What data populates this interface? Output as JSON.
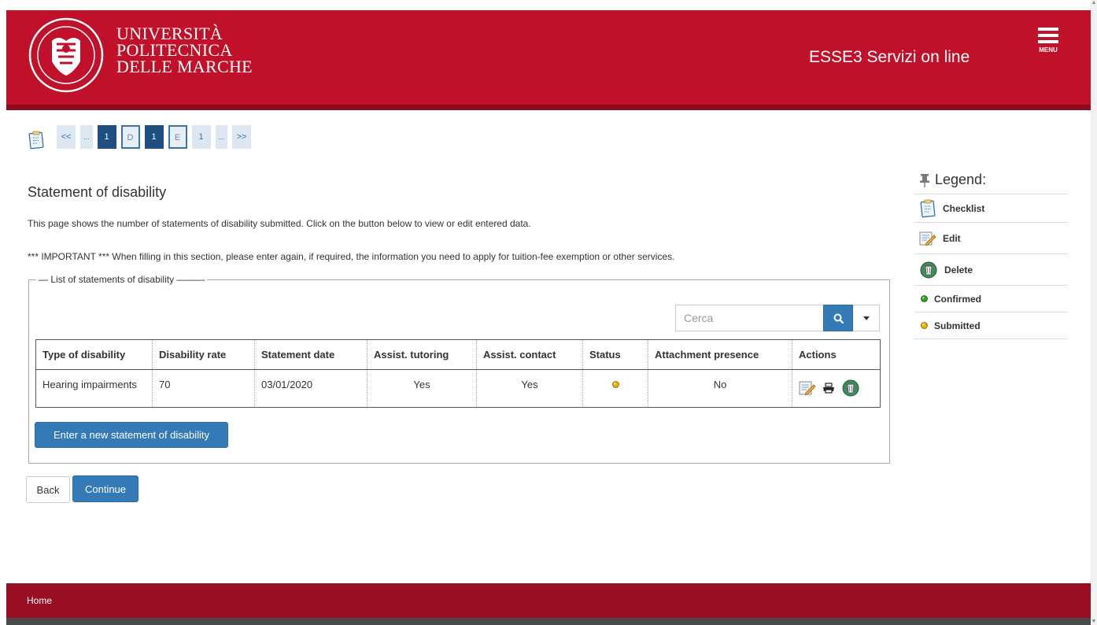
{
  "header": {
    "university_lines": [
      "UNIVERSITÀ",
      "POLITECNICA",
      "DELLE MARCHE"
    ],
    "app_title": "ESSE3 Servizi on line",
    "menu_label": "MENU",
    "brand_color": "#c0102a"
  },
  "pager": {
    "items": [
      "<<",
      "...",
      "1",
      "D",
      "1",
      "E",
      "1",
      "...",
      ">>"
    ],
    "active_index": 4,
    "outlined_indices": [
      3,
      5
    ]
  },
  "page": {
    "title": "Statement of disability",
    "description": "This page shows the number of statements of disability submitted. Click on the button below to view or edit entered data.",
    "important_note": "*** IMPORTANT *** When filling in this section, please enter again, if required, the information you need to apply for tuition-fee exemption or other services."
  },
  "list": {
    "legend": "List of statements of disability",
    "search_placeholder": "Cerca",
    "columns": [
      "Type of disability",
      "Disability rate",
      "Statement date",
      "Assist. tutoring",
      "Assist. contact",
      "Status",
      "Attachment presence",
      "Actions"
    ],
    "rows": [
      {
        "type": "Hearing impairments",
        "rate": "70",
        "date": "03/01/2020",
        "tutoring": "Yes",
        "contact": "Yes",
        "status": "submitted",
        "attachment": "No",
        "actions": [
          "edit-icon",
          "print-icon",
          "delete-icon"
        ]
      }
    ],
    "new_button": "Enter a new statement of disability"
  },
  "nav": {
    "back": "Back",
    "continue": "Continue"
  },
  "legend": {
    "title": "Legend:",
    "items": [
      {
        "icon": "checklist-icon",
        "label": "Checklist"
      },
      {
        "icon": "edit-icon",
        "label": "Edit"
      },
      {
        "icon": "delete-icon",
        "label": "Delete"
      },
      {
        "icon": "green-dot-icon",
        "label": "Confirmed"
      },
      {
        "icon": "yellow-dot-icon",
        "label": "Submitted"
      }
    ]
  },
  "footer": {
    "home": "Home"
  },
  "colors": {
    "status_confirmed": "#3a9a2a",
    "status_submitted": "#e0b400",
    "primary_button": "#337ab7"
  }
}
